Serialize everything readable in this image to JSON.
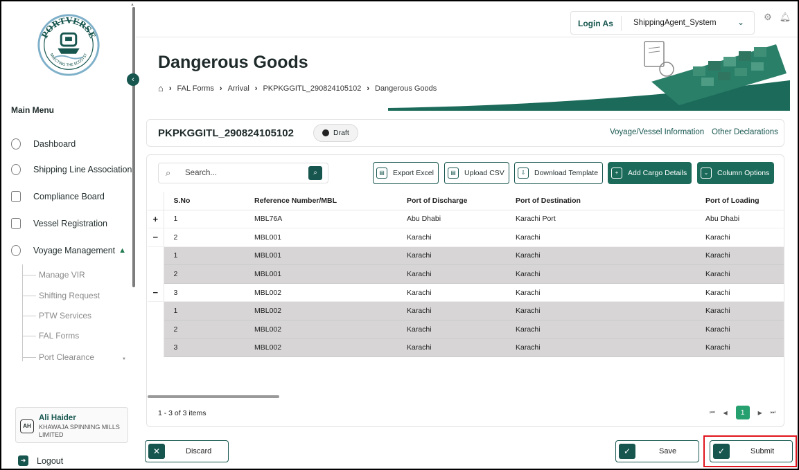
{
  "sidebar": {
    "logo_text": "PORTVERSE",
    "logo_tagline": "CONNECTING THE ECOSYSTEM",
    "main_menu": "Main Menu",
    "items": [
      {
        "label": "Dashboard",
        "icon": "dashboard-icon"
      },
      {
        "label": "Shipping Line Association",
        "icon": "association-icon"
      },
      {
        "label": "Compliance Board",
        "icon": "document-icon"
      },
      {
        "label": "Vessel Registration",
        "icon": "building-icon"
      },
      {
        "label": "Voyage Management",
        "icon": "compass-icon"
      }
    ],
    "sub_items": [
      "Manage VIR",
      "Shifting Request",
      "PTW Services",
      "FAL Forms",
      "Port Clearance"
    ],
    "user": {
      "initials": "AH",
      "name": "Ali Haider",
      "org": "KHAWAJA SPINNING MILLS LIMITED"
    },
    "logout": "Logout"
  },
  "topbar": {
    "login_label": "Login As",
    "login_value": "ShippingAgent_System"
  },
  "header": {
    "title": "Dangerous Goods",
    "breadcrumb": [
      "FAL Forms",
      "Arrival",
      "PKPKGGITL_290824105102",
      "Dangerous Goods"
    ]
  },
  "record": {
    "reference": "PKPKGGITL_290824105102",
    "status": "Draft",
    "links": [
      "Voyage/Vessel Information",
      "Other Declarations"
    ]
  },
  "toolbar": {
    "search_placeholder": "Search...",
    "export_excel": "Export Excel",
    "upload_csv": "Upload CSV",
    "download_template": "Download Template",
    "add_cargo": "Add Cargo Details",
    "column_options": "Column Options"
  },
  "table": {
    "columns": [
      "S.No",
      "Reference Number/MBL",
      "Port of Discharge",
      "Port of Destination",
      "Port of Loading"
    ],
    "rows": [
      {
        "expander": "+",
        "child": false,
        "cells": [
          "1",
          "MBL76A",
          "Abu Dhabi",
          "Karachi Port",
          "Abu Dhabi"
        ]
      },
      {
        "expander": "−",
        "child": false,
        "cells": [
          "2",
          "MBL001",
          "Karachi",
          "Karachi",
          "Karachi"
        ]
      },
      {
        "expander": "",
        "child": true,
        "cells": [
          "1",
          "MBL001",
          "Karachi",
          "Karachi",
          "Karachi"
        ]
      },
      {
        "expander": "",
        "child": true,
        "cells": [
          "2",
          "MBL001",
          "Karachi",
          "Karachi",
          "Karachi"
        ]
      },
      {
        "expander": "−",
        "child": false,
        "cells": [
          "3",
          "MBL002",
          "Karachi",
          "Karachi",
          "Karachi"
        ]
      },
      {
        "expander": "",
        "child": true,
        "cells": [
          "1",
          "MBL002",
          "Karachi",
          "Karachi",
          "Karachi"
        ]
      },
      {
        "expander": "",
        "child": true,
        "cells": [
          "2",
          "MBL002",
          "Karachi",
          "Karachi",
          "Karachi"
        ]
      },
      {
        "expander": "",
        "child": true,
        "cells": [
          "3",
          "MBL002",
          "Karachi",
          "Karachi",
          "Karachi"
        ]
      }
    ]
  },
  "pager": {
    "info": "1 - 3 of 3 items",
    "current_page": "1"
  },
  "footer": {
    "discard": "Discard",
    "save": "Save",
    "submit": "Submit"
  },
  "colors": {
    "brand": "#17564f",
    "accent": "#26a06f",
    "highlight": "#e0141c",
    "child_row": "#d7d5d5"
  }
}
